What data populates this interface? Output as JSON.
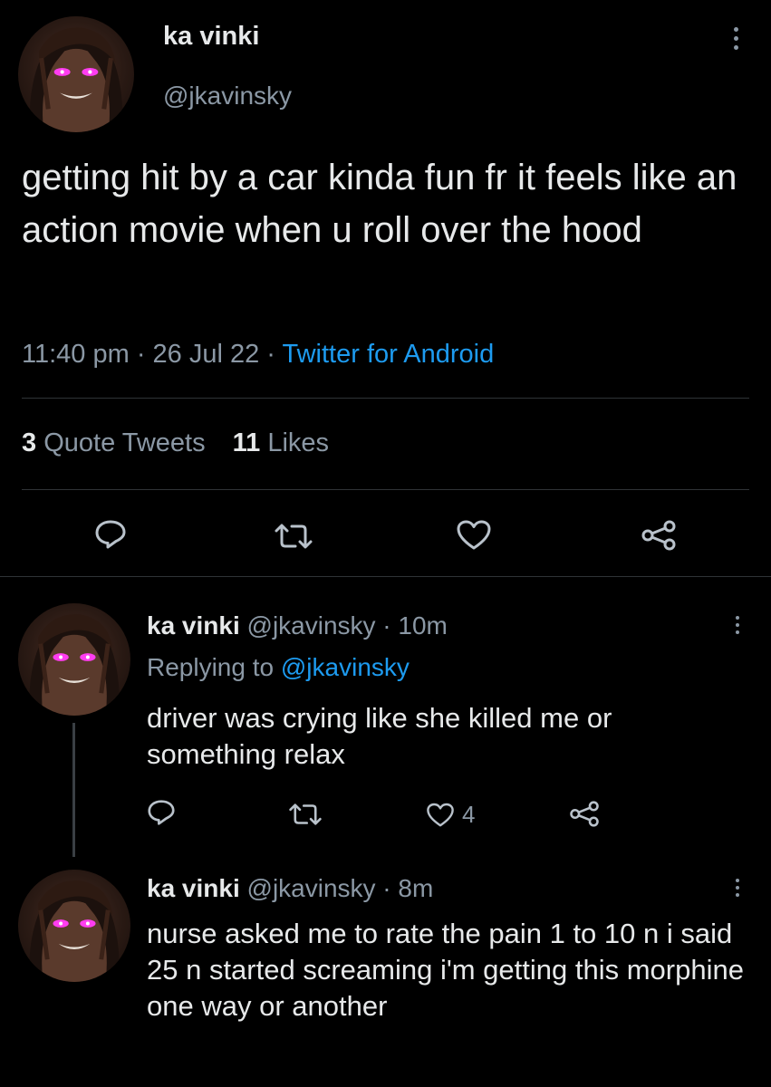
{
  "main_tweet": {
    "author_name": "ka vinki",
    "handle": "@jkavinsky",
    "text": "getting hit by a car kinda fun fr it feels like an action movie when u roll over the hood",
    "time": "11:40 pm",
    "separator1": " · ",
    "date": "26 Jul 22",
    "separator2": " · ",
    "source": "Twitter for Android",
    "quote_tweets_count": "3",
    "quote_tweets_label": "Quote Tweets",
    "likes_count": "11",
    "likes_label": "Likes"
  },
  "replies": [
    {
      "author_name": "ka vinki",
      "handle_time": "@jkavinsky · 10m",
      "replying_prefix": "Replying to ",
      "replying_to": "@jkavinsky",
      "text": "driver was crying like she killed me or something relax",
      "like_count": "4"
    },
    {
      "author_name": "ka vinki",
      "handle_time": "@jkavinsky · 8m",
      "text": "nurse asked me to rate the pain 1 to 10 n i said 25 n started screaming i'm getting this morphine one way or another"
    }
  ],
  "icons": {
    "reply": "reply-icon",
    "retweet": "retweet-icon",
    "like": "like-icon",
    "share": "share-icon",
    "more": "more-icon"
  },
  "colors": {
    "background": "#000000",
    "text_primary": "#e7e9ea",
    "text_secondary": "#8b98a5",
    "link": "#1d9bf0",
    "eye_glow": "#ff3df0"
  }
}
